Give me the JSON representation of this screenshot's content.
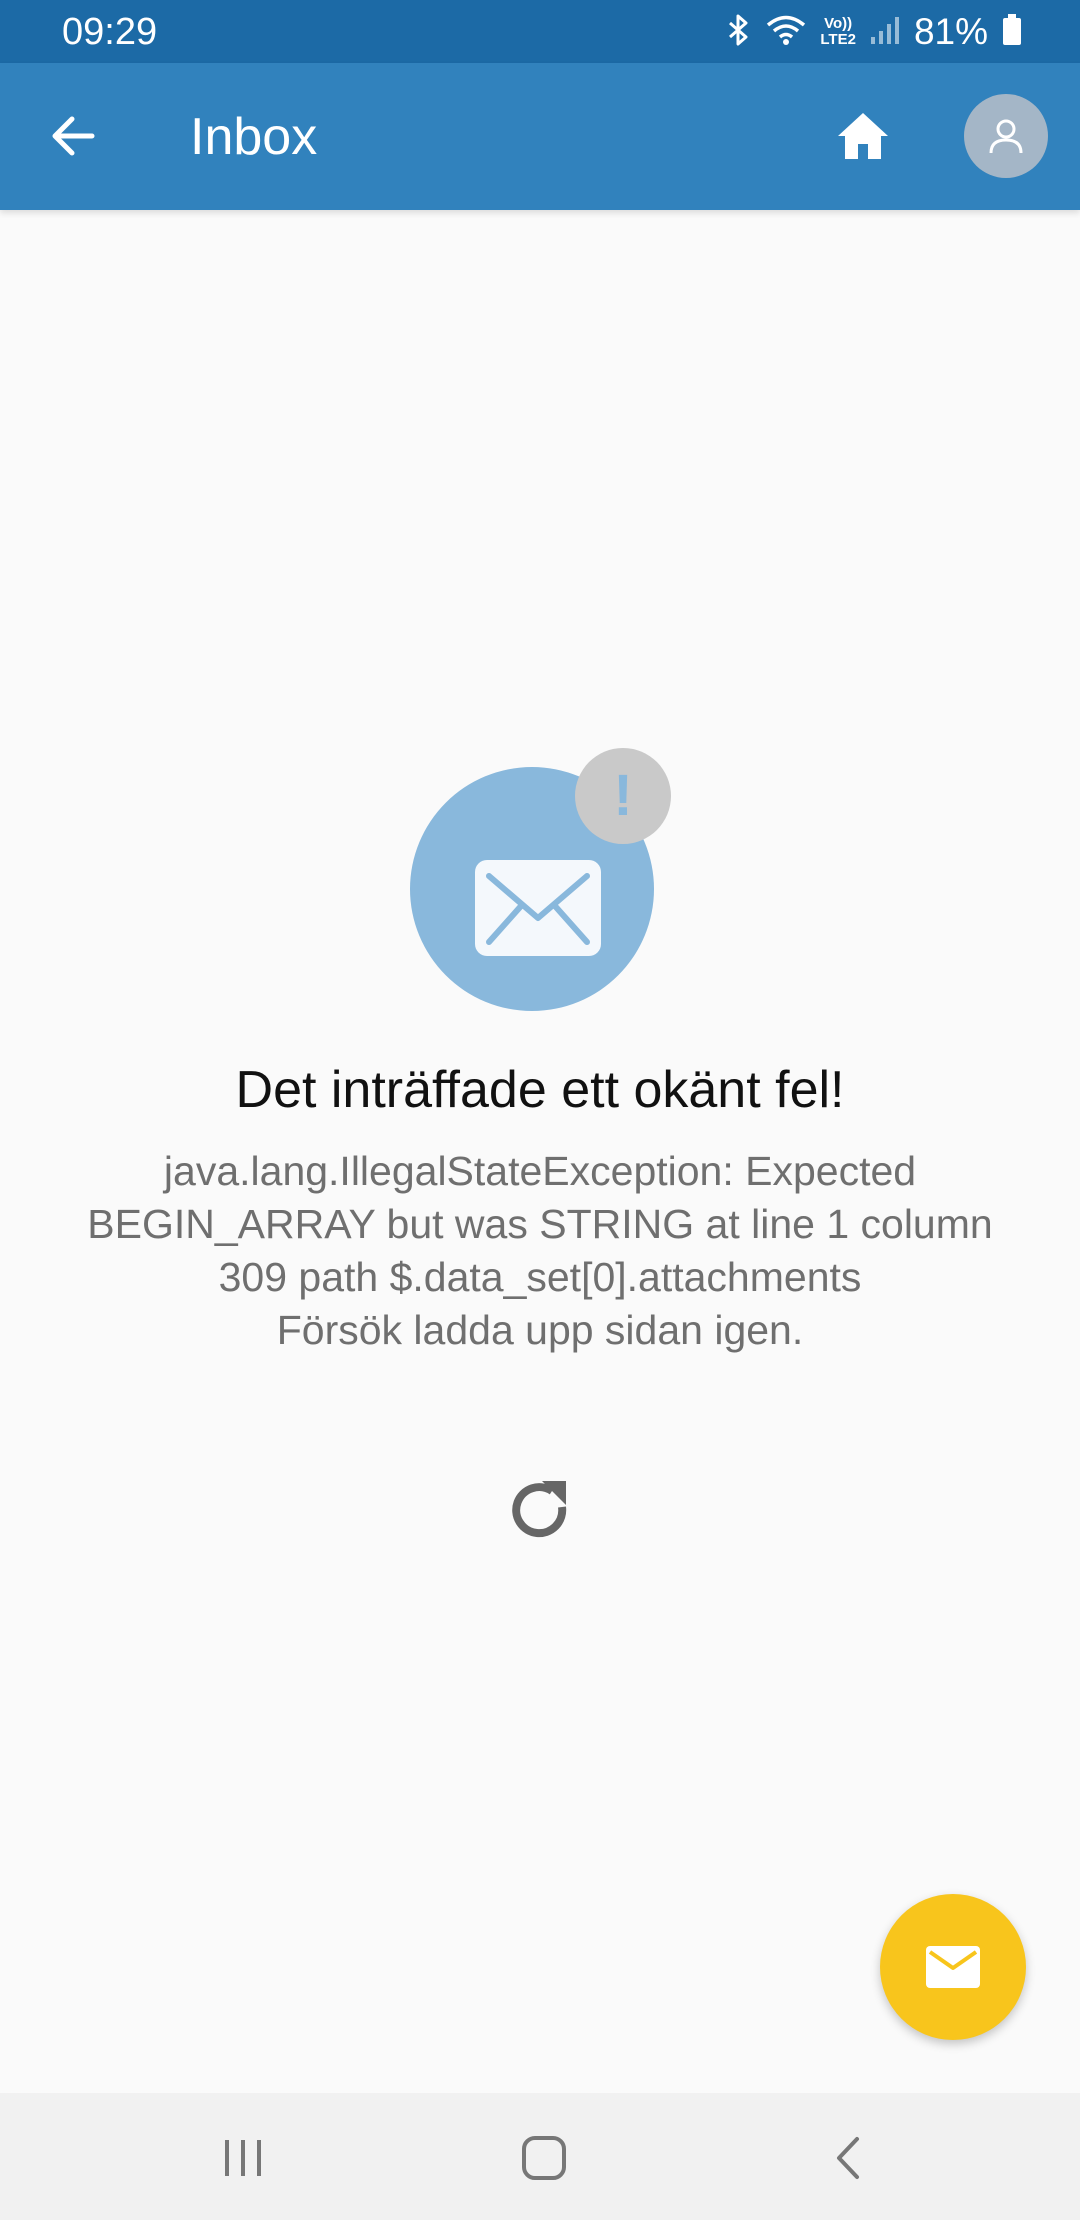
{
  "status_bar": {
    "time": "09:29",
    "battery_percent": "81%",
    "network_label_top": "Vo))",
    "network_label_bottom": "LTE2",
    "icons": [
      "bluetooth-icon",
      "wifi-icon",
      "volte-lte-icon",
      "signal-icon",
      "battery-icon"
    ],
    "background_color": "#1c6aa6"
  },
  "app_bar": {
    "title": "Inbox",
    "back_icon": "arrow-left-icon",
    "home_icon": "home-icon",
    "avatar_icon": "user-icon",
    "background_color": "#3182bd"
  },
  "error": {
    "illustration_icons": [
      "envelope-icon",
      "exclamation-badge-icon"
    ],
    "badge_text": "!",
    "title": "Det inträffade ett okänt fel!",
    "message_lines": [
      "java.lang.IllegalStateException: Expected",
      "BEGIN_ARRAY but was STRING at line 1 column",
      "309 path $.data_set[0].attachments",
      "Försök ladda upp sidan igen."
    ],
    "reload_icon": "refresh-icon"
  },
  "fab": {
    "icon": "envelope-icon",
    "color": "#f8c51c"
  },
  "nav_bar": {
    "icons": [
      "recent-apps-icon",
      "home-nav-icon",
      "back-nav-icon"
    ]
  }
}
